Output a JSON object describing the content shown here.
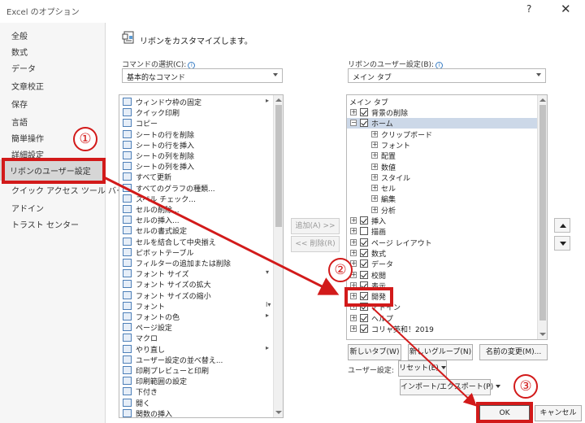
{
  "window": {
    "title": "Excel のオプション",
    "help_glyph": "?",
    "close_glyph": "✕"
  },
  "sidebar": {
    "items": [
      {
        "label": "全般"
      },
      {
        "label": "数式"
      },
      {
        "label": "データ"
      },
      {
        "label": "文章校正"
      },
      {
        "label": "保存"
      },
      {
        "label": "言語"
      },
      {
        "label": "簡単操作"
      },
      {
        "label": "詳細設定"
      },
      {
        "label": "リボンのユーザー設定",
        "selected": true
      },
      {
        "label": "クイック アクセス ツール バー"
      },
      {
        "label": "アドイン"
      },
      {
        "label": "トラスト センター"
      }
    ]
  },
  "header": {
    "text": "リボンをカスタマイズします。"
  },
  "commands": {
    "label": "コマンドの選択(C):",
    "selected": "基本的なコマンド",
    "items": [
      {
        "label": "ウィンドウ枠の固定",
        "sub": "▸"
      },
      {
        "label": "クイック印刷"
      },
      {
        "label": "コピー"
      },
      {
        "label": "シートの行を削除"
      },
      {
        "label": "シートの行を挿入"
      },
      {
        "label": "シートの列を削除"
      },
      {
        "label": "シートの列を挿入"
      },
      {
        "label": "すべて更新"
      },
      {
        "label": "すべてのグラフの種類..."
      },
      {
        "label": "スペル チェック..."
      },
      {
        "label": "セルの削除..."
      },
      {
        "label": "セルの挿入..."
      },
      {
        "label": "セルの書式設定"
      },
      {
        "label": "セルを結合して中央揃え"
      },
      {
        "label": "ピボットテーブル"
      },
      {
        "label": "フィルターの追加または削除"
      },
      {
        "label": "フォント サイズ",
        "sub": "▾"
      },
      {
        "label": "フォント サイズの拡大"
      },
      {
        "label": "フォント サイズの縮小"
      },
      {
        "label": "フォント",
        "sub": "I▾"
      },
      {
        "label": "フォントの色",
        "sub": "▸"
      },
      {
        "label": "ページ設定"
      },
      {
        "label": "マクロ"
      },
      {
        "label": "やり直し",
        "sub": "▸"
      },
      {
        "label": "ユーザー設定の並べ替え..."
      },
      {
        "label": "印刷プレビューと印刷"
      },
      {
        "label": "印刷範囲の設定"
      },
      {
        "label": "下付き"
      },
      {
        "label": "開く"
      },
      {
        "label": "関数の挿入"
      }
    ]
  },
  "transfer": {
    "add": "追加(A) >>",
    "remove": "<< 削除(R)"
  },
  "ribbon": {
    "label": "リボンのユーザー設定(B):",
    "selected": "メイン タブ",
    "header": "メイン タブ",
    "nodes": [
      {
        "label": "背景の削除",
        "level": 0,
        "exp": "+",
        "checked": true
      },
      {
        "label": "ホーム",
        "level": 0,
        "exp": "−",
        "checked": true,
        "highlight": true
      },
      {
        "label": "クリップボード",
        "level": 1,
        "exp": "+"
      },
      {
        "label": "フォント",
        "level": 1,
        "exp": "+"
      },
      {
        "label": "配置",
        "level": 1,
        "exp": "+"
      },
      {
        "label": "数値",
        "level": 1,
        "exp": "+"
      },
      {
        "label": "スタイル",
        "level": 1,
        "exp": "+"
      },
      {
        "label": "セル",
        "level": 1,
        "exp": "+"
      },
      {
        "label": "編集",
        "level": 1,
        "exp": "+"
      },
      {
        "label": "分析",
        "level": 1,
        "exp": "+"
      },
      {
        "label": "挿入",
        "level": 0,
        "exp": "+",
        "checked": true
      },
      {
        "label": "描画",
        "level": 0,
        "exp": "+",
        "checked": false
      },
      {
        "label": "ページ レイアウト",
        "level": 0,
        "exp": "+",
        "checked": true
      },
      {
        "label": "数式",
        "level": 0,
        "exp": "+",
        "checked": true
      },
      {
        "label": "データ",
        "level": 0,
        "exp": "+",
        "checked": true
      },
      {
        "label": "校閲",
        "level": 0,
        "exp": "+",
        "checked": true
      },
      {
        "label": "表示",
        "level": 0,
        "exp": "+",
        "checked": true
      },
      {
        "label": "開発",
        "level": 0,
        "exp": "+",
        "checked": true
      },
      {
        "label": "アドイン",
        "level": 0,
        "exp": "+",
        "checked": true
      },
      {
        "label": "ヘルプ",
        "level": 0,
        "exp": "+",
        "checked": true
      },
      {
        "label": "コリャ英和！2019",
        "level": 0,
        "exp": "+",
        "checked": true
      }
    ]
  },
  "ribbon_buttons": {
    "new_tab": "新しいタブ(W)",
    "new_group": "新しいグループ(N)",
    "rename": "名前の変更(M)...",
    "customize_label": "ユーザー設定:",
    "reset": "リセット(E)",
    "import_export": "インポート/エクスポート(P)"
  },
  "footer": {
    "ok": "OK",
    "cancel": "キャンセル"
  },
  "callouts": {
    "one": "①",
    "two": "②",
    "three": "③"
  },
  "colors": {
    "annotation": "#d21a1a"
  }
}
